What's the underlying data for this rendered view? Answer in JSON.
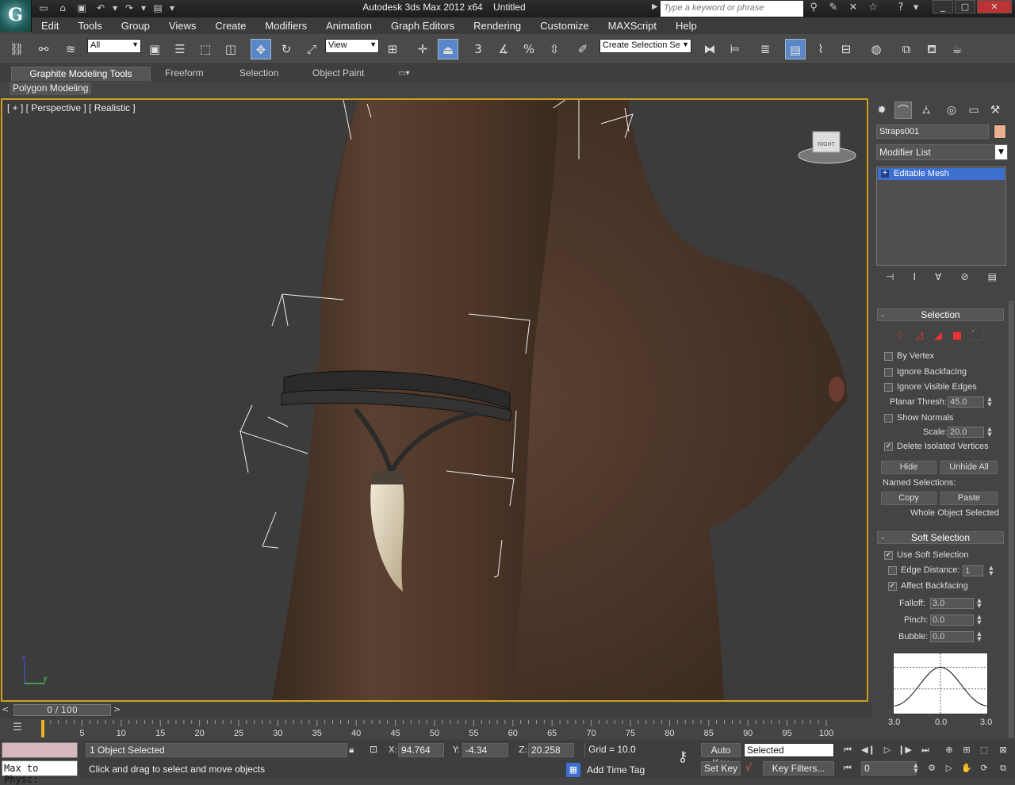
{
  "titlebar": {
    "title": "Autodesk 3ds Max  2012 x64",
    "document": "Untitled",
    "search_placeholder": "Type a keyword or phrase"
  },
  "menu": [
    "Edit",
    "Tools",
    "Group",
    "Views",
    "Create",
    "Modifiers",
    "Animation",
    "Graph Editors",
    "Rendering",
    "Customize",
    "MAXScript",
    "Help"
  ],
  "toolbar": {
    "selection_filter": "All",
    "ref_coord": "View",
    "named_selection": "Create Selection Se"
  },
  "ribbon": {
    "tabs": [
      "Graphite Modeling Tools",
      "Freeform",
      "Selection",
      "Object Paint"
    ],
    "active_tab": "Graphite Modeling Tools",
    "panel_tab": "Polygon Modeling"
  },
  "viewport": {
    "label": "[ + ] [ Perspective ] [ Realistic ]",
    "viewcube_face": "RIGHT",
    "axis_z": "z",
    "axis_y": "y"
  },
  "timeline": {
    "slider_label": "0 / 100",
    "current_frame": 0,
    "start": 0,
    "end": 100,
    "ticks": [
      "5",
      "10",
      "15",
      "20",
      "25",
      "30",
      "35",
      "40",
      "45",
      "50",
      "55",
      "60",
      "65",
      "70",
      "75",
      "80",
      "85",
      "90",
      "95",
      "100"
    ]
  },
  "command_panel": {
    "object_name": "Straps001",
    "object_color": "#e8b090",
    "modifier_list": "Modifier List",
    "stack_item": "Editable Mesh",
    "selection": {
      "header": "Selection",
      "by_vertex": "By Vertex",
      "ignore_backfacing": "Ignore Backfacing",
      "ignore_visible_edges": "Ignore Visible Edges",
      "planar_thresh_label": "Planar Thresh:",
      "planar_thresh": "45.0",
      "show_normals": "Show Normals",
      "scale_label": "Scale:",
      "scale": "20.0",
      "delete_isolated": "Delete Isolated Vertices",
      "delete_isolated_checked": true,
      "hide": "Hide",
      "unhide_all": "Unhide All",
      "named_selections": "Named Selections:",
      "copy": "Copy",
      "paste": "Paste",
      "status": "Whole Object Selected"
    },
    "soft_selection": {
      "header": "Soft Selection",
      "use_soft_selection": "Use Soft Selection",
      "use_soft_checked": true,
      "edge_distance": "Edge Distance:",
      "edge_distance_val": "1",
      "affect_backfacing": "Affect Backfacing",
      "affect_backfacing_checked": true,
      "falloff_label": "Falloff:",
      "falloff": "3.0",
      "pinch_label": "Pinch:",
      "pinch": "0.0",
      "bubble_label": "Bubble:",
      "bubble": "0.0",
      "graph_left": "3.0",
      "graph_mid": "0.0",
      "graph_right": "3.0"
    }
  },
  "status": {
    "script_listener": "",
    "script_text": "Max to Physc:",
    "objects_selected": "1 Object Selected",
    "prompt": "Click and drag to select and move objects",
    "x_label": "X:",
    "x": "94.764",
    "y_label": "Y:",
    "y": "-4.34",
    "z_label": "Z:",
    "z": "20.258",
    "grid": "Grid = 10.0",
    "add_time_tag": "Add Time Tag",
    "auto_key": "Auto Key",
    "set_key": "Set Key",
    "key_mode": "Selected",
    "key_filters": "Key Filters...",
    "frame": "0"
  }
}
